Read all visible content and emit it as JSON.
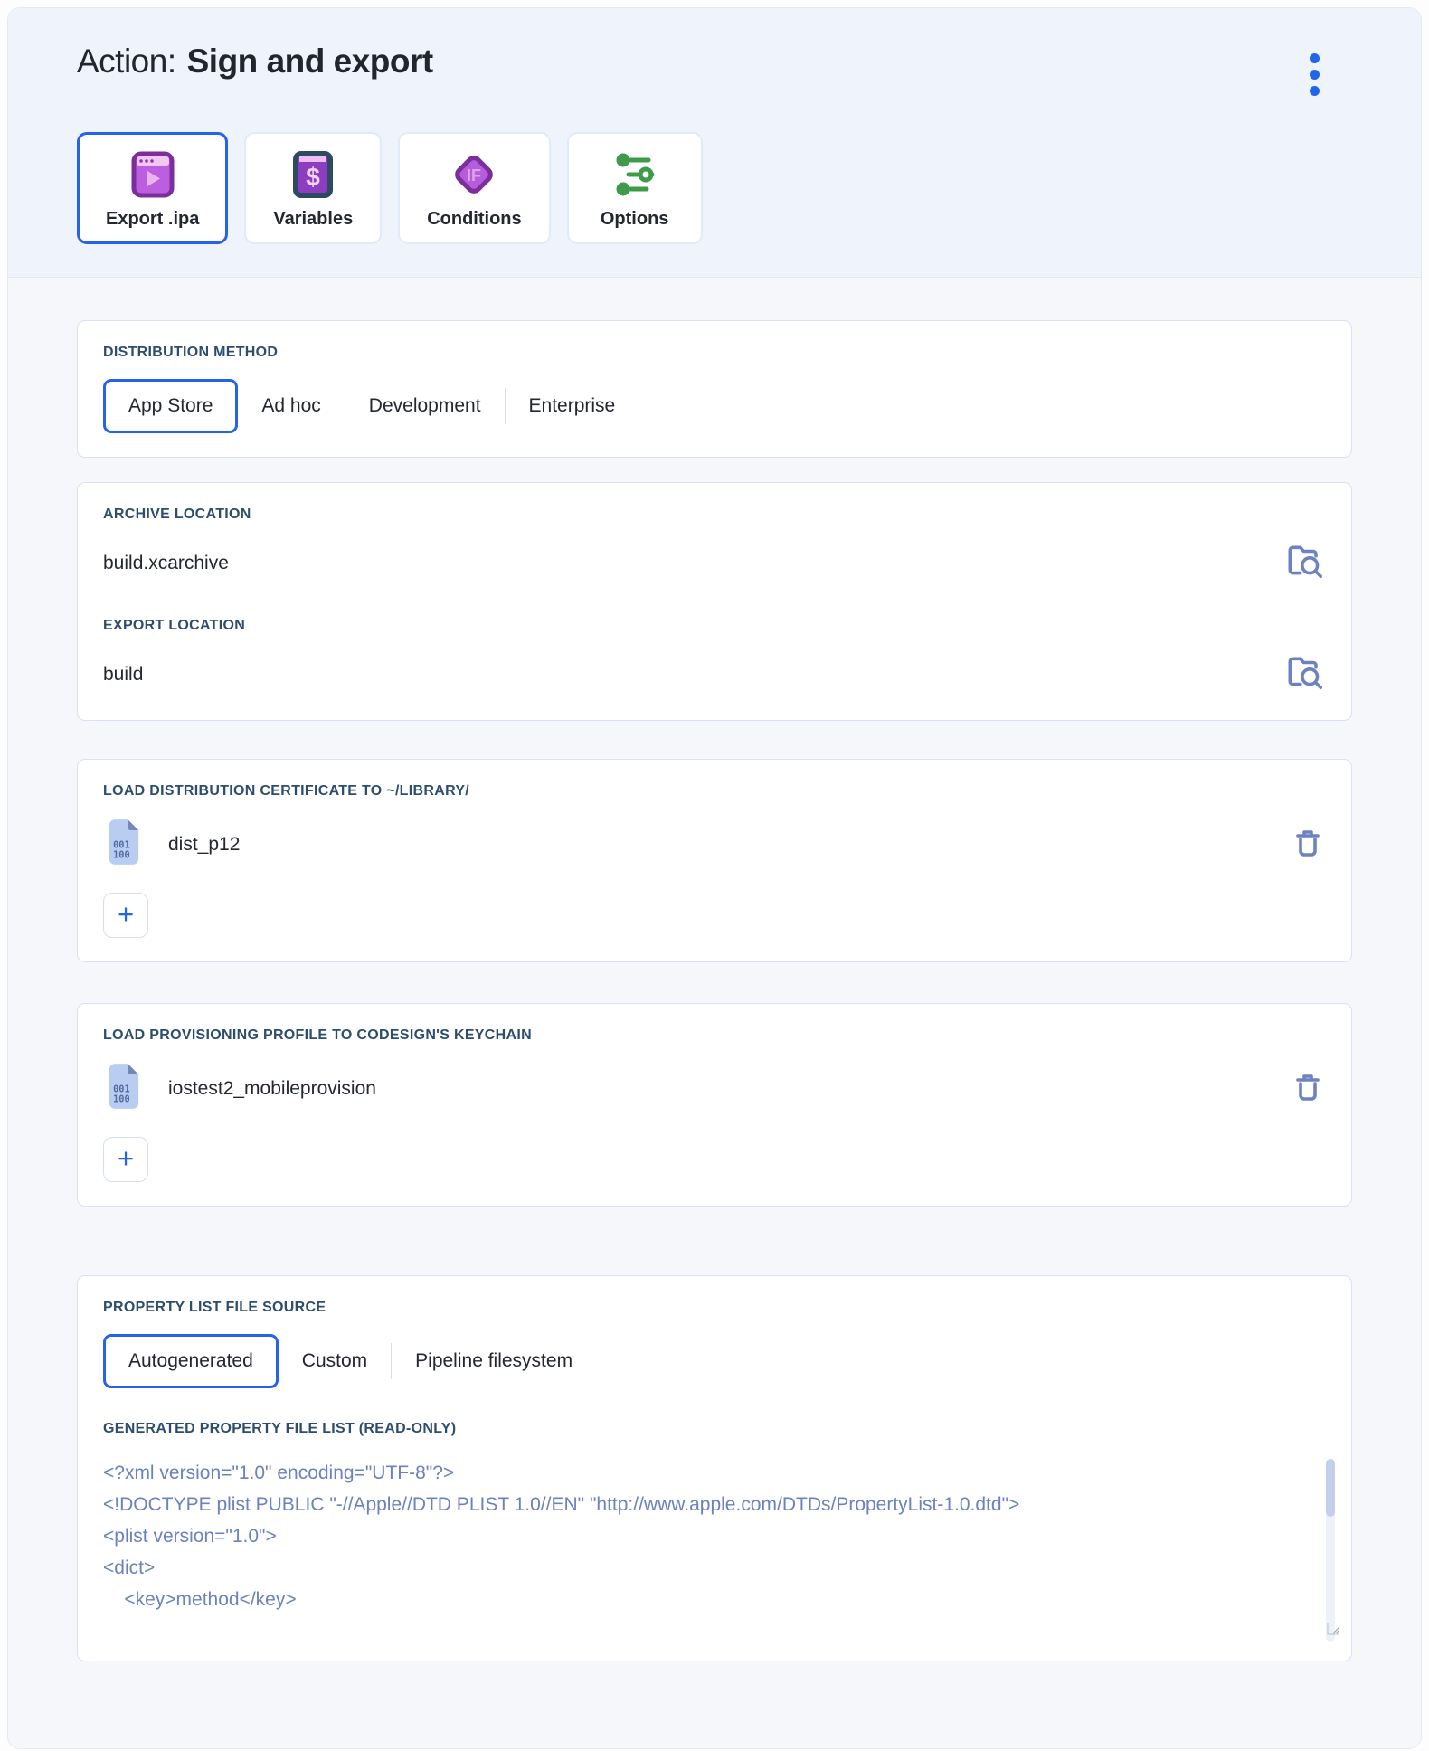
{
  "header": {
    "title_prefix": "Action:",
    "title": "Sign and export"
  },
  "tabs": [
    {
      "label": "Export .ipa",
      "icon": "app-window-play-icon",
      "selected": true
    },
    {
      "label": "Variables",
      "icon": "dollar-book-icon",
      "selected": false
    },
    {
      "label": "Conditions",
      "icon": "if-diamond-icon",
      "selected": false
    },
    {
      "label": "Options",
      "icon": "sliders-icon",
      "selected": false
    }
  ],
  "distribution": {
    "label": "DISTRIBUTION METHOD",
    "options": [
      "App Store",
      "Ad hoc",
      "Development",
      "Enterprise"
    ],
    "selected": "App Store"
  },
  "locations": {
    "archive_label": "ARCHIVE LOCATION",
    "archive_value": "build.xcarchive",
    "export_label": "EXPORT LOCATION",
    "export_value": "build",
    "browse_icon": "folder-search-icon"
  },
  "certificate": {
    "label": "LOAD DISTRIBUTION CERTIFICATE TO ~/LIBRARY/",
    "file_name": "dist_p12",
    "file_icon": "binary-file-icon",
    "remove_icon": "trash-icon",
    "add_label": "+"
  },
  "profile": {
    "label": "LOAD PROVISIONING PROFILE TO CODESIGN'S KEYCHAIN",
    "file_name": "iostest2_mobileprovision",
    "file_icon": "binary-file-icon",
    "remove_icon": "trash-icon",
    "add_label": "+"
  },
  "plist": {
    "source_label": "PROPERTY LIST FILE SOURCE",
    "source_options": [
      "Autogenerated",
      "Custom",
      "Pipeline filesystem"
    ],
    "source_selected": "Autogenerated",
    "generated_label": "GENERATED PROPERTY FILE LIST (READ-ONLY)",
    "xml_lines": [
      "<?xml version=\"1.0\" encoding=\"UTF-8\"?>",
      "<!DOCTYPE plist PUBLIC \"-//Apple//DTD PLIST 1.0//EN\" \"http://www.apple.com/DTDs/PropertyList-1.0.dtd\">",
      "<plist version=\"1.0\">",
      "<dict>",
      "    <key>method</key>"
    ]
  },
  "colors": {
    "accent_blue": "#2563eb",
    "label_navy": "#2d4d6e",
    "slate_icon": "#6d83c1",
    "xml_text": "#6b81c0",
    "green_icon": "#3f9b4a",
    "purple_icon": "#b55ddd",
    "header_bg": "#eff3fb",
    "body_bg": "#f5f7fa"
  }
}
